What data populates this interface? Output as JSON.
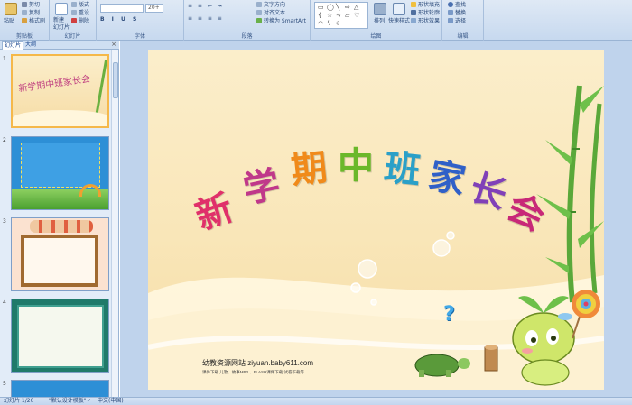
{
  "ribbon": {
    "clipboard": {
      "paste": "粘贴",
      "cut": "剪切",
      "copy": "复制",
      "format_painter": "格式刷",
      "group": "剪贴板"
    },
    "slides": {
      "new_slide": "新建\n幻灯片",
      "layout": "版式",
      "reset": "重设",
      "delete": "删除",
      "group": "幻灯片"
    },
    "font": {
      "size": "20+",
      "group": "字体"
    },
    "paragraph": {
      "text_direction": "文字方向",
      "align_text": "对齐文本",
      "smartart": "转换为 SmartArt",
      "group": "段落"
    },
    "drawing": {
      "arrange": "排列",
      "quick_styles": "快速样式",
      "shape_fill": "形状填充",
      "shape_outline": "形状轮廓",
      "shape_effects": "形状效果",
      "group": "绘图"
    },
    "editing": {
      "find": "查找",
      "replace": "替换",
      "select": "选择",
      "group": "编辑"
    }
  },
  "panel": {
    "tab_slides": "幻灯片",
    "tab_outline": "大纲",
    "thumbs": [
      {
        "num": "1",
        "title": "新学期中班家长会"
      },
      {
        "num": "2",
        "title": ""
      },
      {
        "num": "3",
        "title": ""
      },
      {
        "num": "4",
        "title": ""
      },
      {
        "num": "5",
        "title": ""
      }
    ]
  },
  "slide": {
    "title": "新学期中班家长会",
    "title_colors": [
      "#e0306a",
      "#c0388a",
      "#f08a1a",
      "#6ab82a",
      "#2aa0c8",
      "#3060c8",
      "#8040b8",
      "#c82878"
    ],
    "site_line": "幼教资源网站  ziyuan.baby611.com",
    "sub_line": "课件下载   儿歌、故事MP3 、FLASH课件下载   试卷下载等",
    "question_mark": "?"
  },
  "status": {
    "slide_no": "幻灯片 1/20",
    "theme": "\"默认设计模板\"",
    "language": "中文(中国)"
  }
}
